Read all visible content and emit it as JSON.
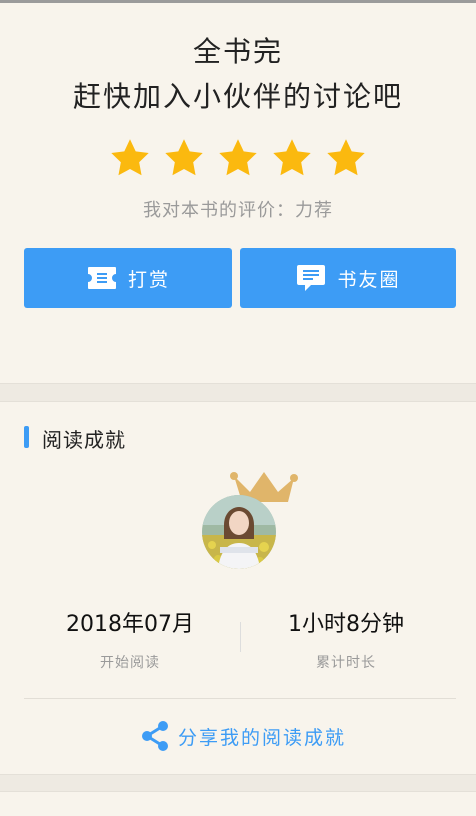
{
  "header": {
    "line1": "全书完",
    "line2": "赶快加入小伙伴的讨论吧"
  },
  "rating": {
    "stars_filled": 5,
    "stars_total": 5,
    "star_color": "#fbb90f",
    "text": "我对本书的评价：力荐"
  },
  "actions": {
    "reward_label": "打赏",
    "reward_icon": "ticket-icon",
    "circle_label": "书友圈",
    "circle_icon": "chat-bubble-icon",
    "accent": "#3d9cf5"
  },
  "achievement": {
    "title": "阅读成就",
    "avatar_icon": "user-avatar",
    "crown_icon": "crown-icon",
    "start_value": "2018年07月",
    "start_label": "开始阅读",
    "duration_value": "1小时8分钟",
    "duration_label": "累计时长",
    "share_label": "分享我的阅读成就",
    "share_icon": "share-icon"
  }
}
